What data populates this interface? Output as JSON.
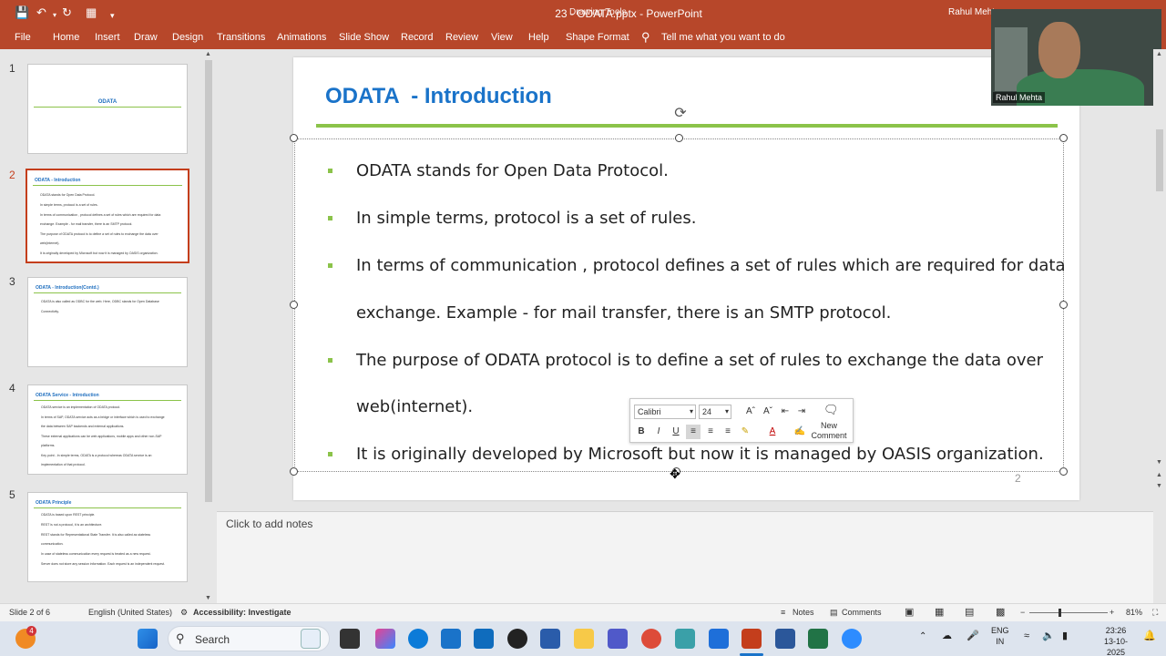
{
  "titlebar": {
    "doc_title": "23 - ODATA.pptx  -  PowerPoint",
    "drawing_tools": "Drawing Tools",
    "user": "Rahul Mehta"
  },
  "ribbon": {
    "tabs": [
      "File",
      "Home",
      "Insert",
      "Draw",
      "Design",
      "Transitions",
      "Animations",
      "Slide Show",
      "Record",
      "Review",
      "View",
      "Help",
      "Shape Format"
    ],
    "tell_me": "Tell me what you want to do"
  },
  "thumbnails": [
    {
      "num": "1",
      "title": "ODATA",
      "bullets": []
    },
    {
      "num": "2",
      "title": "ODATA - Introduction",
      "bullets": [
        "ODATA stands for Open Data Protocol.",
        "In simple terms, protocol is a set of rules.",
        "In terms of communication , protocol defines a set of rules which are required for data",
        "exchange. Example - for mail transfer, there is an SMTP protocol.",
        "The purpose of ODATA protocol is to define a set of rules to exchange the data over",
        "web(internet).",
        "It is originally developed by Microsoft but now it is managed by OASIS organization."
      ]
    },
    {
      "num": "3",
      "title": "ODATA - Introduction(Contd.)",
      "bullets": [
        "ODATA is also called as ODBC for the web. Here, ODBC stands for Open Database",
        "Connectivity."
      ]
    },
    {
      "num": "4",
      "title": "ODATA Service - Introduction",
      "bullets": [
        "ODATA service is an implementation of ODATA protocol.",
        "In terms of SAP, ODATA service acts as a bridge or interface which is used to exchange",
        "the data between SAP backends and external applications.",
        "These external applications can be web applications, mobile apps and other non-SAP",
        "platforms.",
        "Key point - In simple terms, ODATA is a protocol whereas ODATA service is an",
        "implementation of that protocol."
      ]
    },
    {
      "num": "5",
      "title": "ODATA Principle",
      "bullets": [
        "ODATA is based upon REST principle.",
        "REST is not a protocol, it is an architecture.",
        "REST stands for Representational State Transfer. It is also called as stateless",
        "communication.",
        "In case of stateless communication every request is treated as a new request.",
        "Server does not store any session information. Each request is an independent request."
      ]
    }
  ],
  "slide": {
    "title": "ODATA  - Introduction",
    "bullets": [
      "ODATA stands for Open Data Protocol.",
      "In simple terms, protocol is a set of rules.",
      "In terms of communication , protocol defines a set of rules which are required for data",
      "exchange. Example - for mail transfer, there is an SMTP protocol.",
      "The purpose of ODATA protocol is to define a set of rules to exchange the data over",
      "web(internet).",
      "It is originally developed by Microsoft but now it is managed by OASIS organization."
    ],
    "page_number": "2"
  },
  "mini_toolbar": {
    "font": "Calibri",
    "size": "24",
    "new_comment": "New Comment"
  },
  "webcam": {
    "name": "Rahul Mehta"
  },
  "notes": {
    "placeholder": "Click to add notes"
  },
  "status": {
    "slide_info": "Slide 2 of 6",
    "language": "English (United States)",
    "accessibility": "Accessibility: Investigate",
    "notes": "Notes",
    "comments": "Comments",
    "zoom": "81%"
  },
  "taskbar": {
    "search": "Search",
    "lang_top": "ENG",
    "lang_bottom": "IN",
    "time": "23:26",
    "date": "13-10-2025",
    "badge": "4"
  },
  "colors": {
    "accent": "#b7472a",
    "title_blue": "#1a73c9",
    "rule_green": "#8bc34a"
  }
}
